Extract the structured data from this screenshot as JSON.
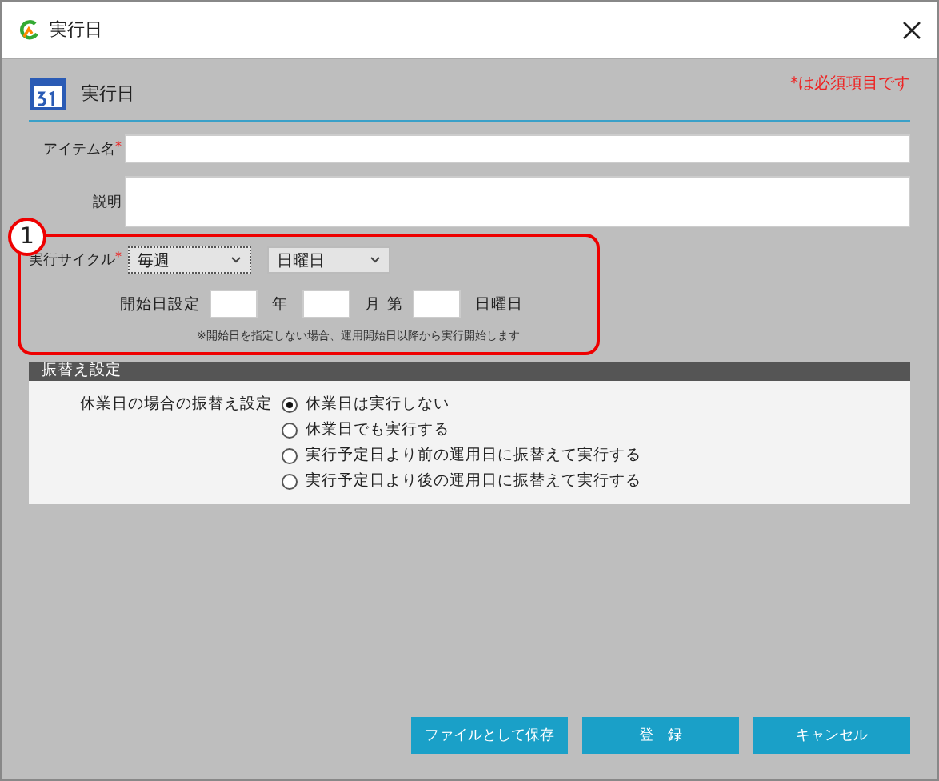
{
  "window": {
    "title": "実行日"
  },
  "header": {
    "title": "実行日",
    "required_note": "*は必須項目です"
  },
  "fields": {
    "item_name": {
      "label": "アイテム名",
      "required_mark": "*"
    },
    "description": {
      "label": "説明"
    }
  },
  "cycle": {
    "label": "実行サイクル",
    "required_mark": "*",
    "frequency": "毎週",
    "weekday": "日曜日",
    "start_label": "開始日設定",
    "year_unit": "年",
    "month_unit": "月",
    "ordinal_prefix": "第",
    "weekday_suffix": "日曜日",
    "note": "※開始日を指定しない場合、運用開始日以降から実行開始します"
  },
  "callout": {
    "number": "1"
  },
  "substitution": {
    "section_title": "振替え設定",
    "label": "休業日の場合の振替え設定",
    "options": [
      {
        "label": "休業日は実行しない",
        "selected": true
      },
      {
        "label": "休業日でも実行する",
        "selected": false
      },
      {
        "label": "実行予定日より前の運用日に振替えて実行する",
        "selected": false
      },
      {
        "label": "実行予定日より後の運用日に振替えて実行する",
        "selected": false
      }
    ]
  },
  "buttons": [
    "ファイルとして保存",
    "登　録",
    "キャンセル"
  ]
}
